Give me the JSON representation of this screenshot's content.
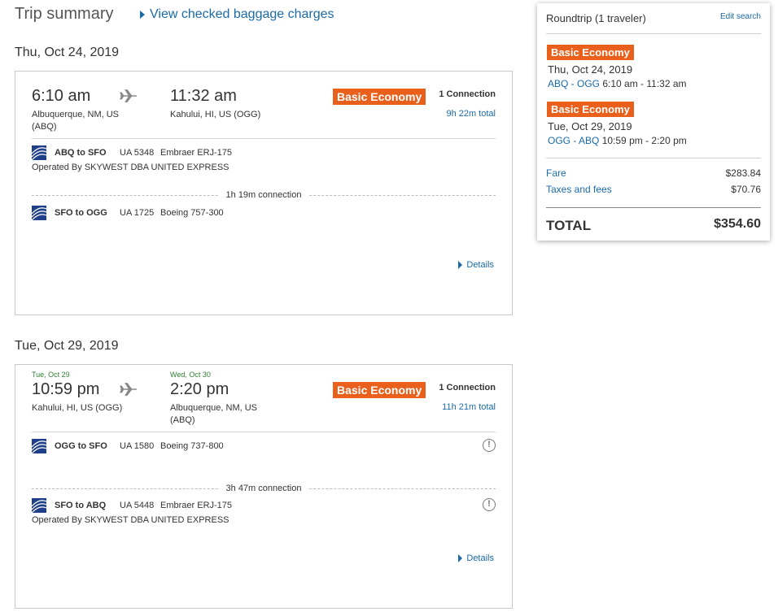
{
  "header": {
    "title": "Trip summary",
    "baggage_link": "View checked baggage charges"
  },
  "colors": {
    "accent": "#e8601c",
    "link": "#1a6aa8",
    "date_green": "#2e7d32"
  },
  "outbound": {
    "date_heading": "Thu, Oct 24, 2019",
    "depart_time": "6:10 am",
    "depart_place": "Albuquerque, NM, US (ABQ)",
    "arrive_time": "11:32 am",
    "arrive_place": "Kahului, HI, US (OGG)",
    "fare_badge": "Basic Economy",
    "connections": "1 Connection",
    "total_duration": "9h 22m total",
    "segments": [
      {
        "route": "ABQ to SFO",
        "flight": "UA 5348",
        "aircraft": "Embraer ERJ-175",
        "operated_by": "Operated By SKYWEST DBA UNITED EXPRESS"
      },
      {
        "route": "SFO to OGG",
        "flight": "UA 1725",
        "aircraft": "Boeing 757-300"
      }
    ],
    "connection_label": "1h 19m connection",
    "details_link": "Details"
  },
  "return": {
    "date_heading": "Tue, Oct 29, 2019",
    "depart_small_date": "Tue, Oct 29",
    "depart_time": "10:59 pm",
    "depart_place": "Kahului, HI, US (OGG)",
    "arrive_small_date": "Wed, Oct 30",
    "arrive_time": "2:20 pm",
    "arrive_place": "Albuquerque, NM, US (ABQ)",
    "fare_badge": "Basic Economy",
    "connections": "1 Connection",
    "total_duration": "11h 21m total",
    "segments": [
      {
        "route": "OGG to SFO",
        "flight": "UA 1580",
        "aircraft": "Boeing 737-800"
      },
      {
        "route": "SFO to ABQ",
        "flight": "UA 5448",
        "aircraft": "Embraer ERJ-175",
        "operated_by": "Operated By SKYWEST DBA UNITED EXPRESS"
      }
    ],
    "connection_label": "3h 47m connection",
    "details_link": "Details",
    "warning_glyph": "!"
  },
  "summary": {
    "title": "Roundtrip (1 traveler)",
    "edit_search": "Edit search",
    "trip1": {
      "badge": "Basic Economy",
      "date": "Thu, Oct 24, 2019",
      "route": "ABQ - OGG",
      "times": "6:10 am - 11:32 am"
    },
    "trip2": {
      "badge": "Basic Economy",
      "date": "Tue, Oct 29, 2019",
      "route": "OGG - ABQ",
      "times": "10:59 pm - 2:20 pm"
    },
    "fare_label": "Fare",
    "fare_value": "$283.84",
    "taxes_label": "Taxes and fees",
    "taxes_value": "$70.76",
    "total_label": "TOTAL",
    "total_value": "$354.60"
  }
}
